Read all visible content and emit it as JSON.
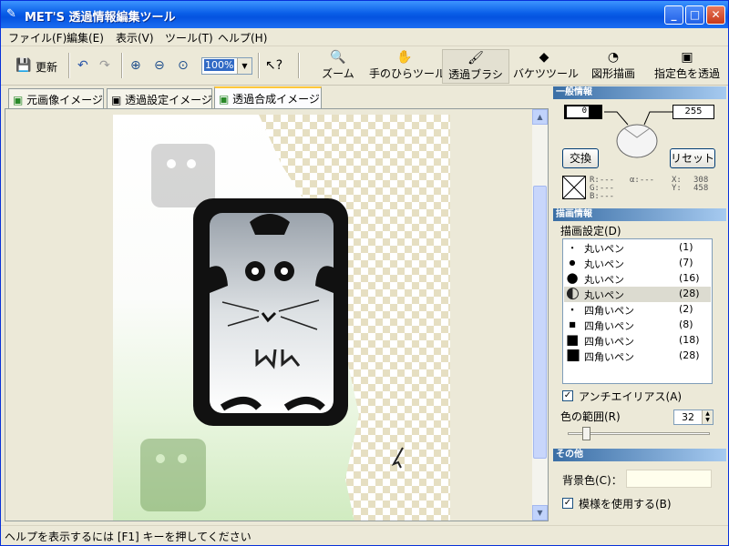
{
  "window": {
    "title": "MET'S 透過情報編集ツール"
  },
  "menu": [
    "ファイル(F)",
    "編集(E)",
    "表示(V)",
    "ツール(T)",
    "ヘルプ(H)"
  ],
  "toolbar": {
    "update": "更新",
    "zoom_value": "100%",
    "tools": [
      "ズーム",
      "手のひらツール",
      "透過ブラシ",
      "バケツツール",
      "図形描画",
      "指定色を透過"
    ]
  },
  "tabs": [
    "元画像イメージ",
    "透過設定イメージ",
    "透過合成イメージ"
  ],
  "panel": {
    "general_title": "一般情報",
    "left_value": "0",
    "right_value": "255",
    "swap": "交換",
    "reset": "リセット",
    "rgb": "R:---\nG:---\nB:---",
    "alpha": "α:---",
    "xy_labels": "X:\nY:",
    "xy_values": "308\n458",
    "draw_title": "描画情報",
    "draw_settings": "描画設定(D)",
    "pens": [
      {
        "name": "丸いペン",
        "size": "(1)"
      },
      {
        "name": "丸いペン",
        "size": "(7)"
      },
      {
        "name": "丸いペン",
        "size": "(16)"
      },
      {
        "name": "丸いペン",
        "size": "(28)"
      },
      {
        "name": "四角いペン",
        "size": "(2)"
      },
      {
        "name": "四角いペン",
        "size": "(8)"
      },
      {
        "name": "四角いペン",
        "size": "(18)"
      },
      {
        "name": "四角いペン",
        "size": "(28)"
      }
    ],
    "antialias": "アンチエイリアス(A)",
    "color_range": "色の範囲(R)",
    "color_range_value": "32",
    "other_title": "その他",
    "bg_color": "背景色(C)：",
    "use_pattern": "模様を使用する(B)"
  },
  "status": "ヘルプを表示するには [F1] キーを押してください"
}
